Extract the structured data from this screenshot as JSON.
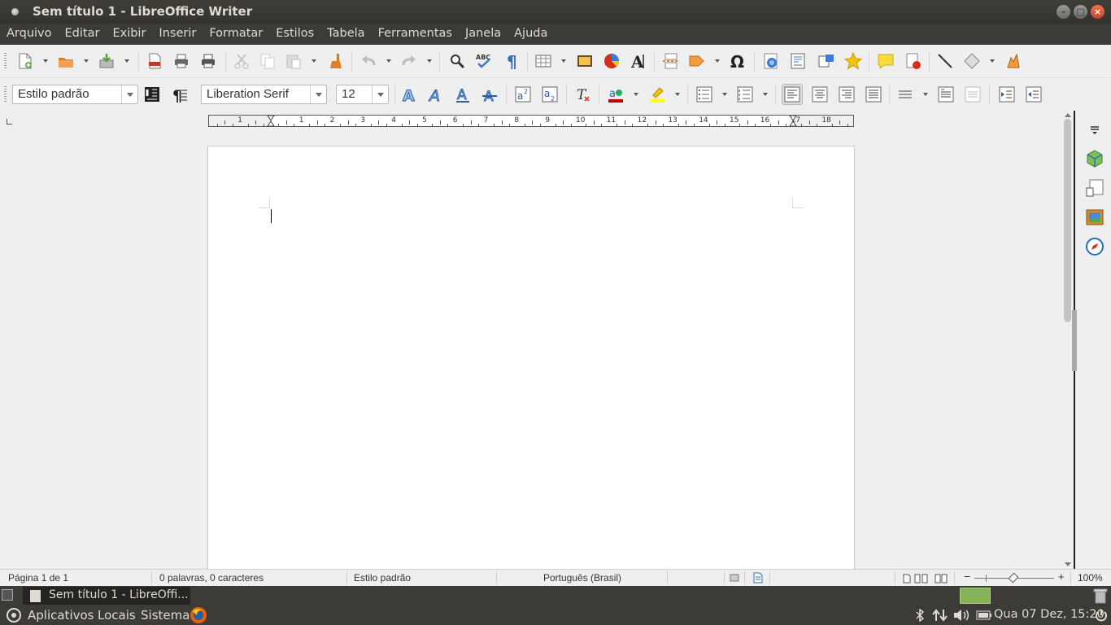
{
  "window": {
    "title": "Sem título 1 - LibreOffice Writer"
  },
  "menu": [
    "Arquivo",
    "Editar",
    "Exibir",
    "Inserir",
    "Formatar",
    "Estilos",
    "Tabela",
    "Ferramentas",
    "Janela",
    "Ajuda"
  ],
  "formatting": {
    "paragraph_style": "Estilo padrão",
    "font_name": "Liberation Serif",
    "font_size": "12"
  },
  "ruler": {
    "numbers": [
      "1",
      "1",
      "2",
      "3",
      "4",
      "5",
      "6",
      "7",
      "8",
      "9",
      "10",
      "11",
      "12",
      "13",
      "14",
      "15",
      "16",
      "17",
      "18"
    ]
  },
  "statusbar": {
    "page": "Página 1 de 1",
    "word_count": "0 palavras, 0 caracteres",
    "page_style": "Estilo padrão",
    "language": "Português (Brasil)",
    "zoom": "100%"
  },
  "taskbar": {
    "task_label": "Sem título 1 - LibreOffi..."
  },
  "panel": {
    "menus": [
      "Aplicativos",
      "Locais",
      "Sistema"
    ],
    "clock": "Qua 07 Dez, 15:20"
  },
  "colors": {
    "titlebar": "#3c3b37",
    "workspace_active": "#86b35a",
    "font_color": "#c00000",
    "highlight": "#ffff00"
  }
}
